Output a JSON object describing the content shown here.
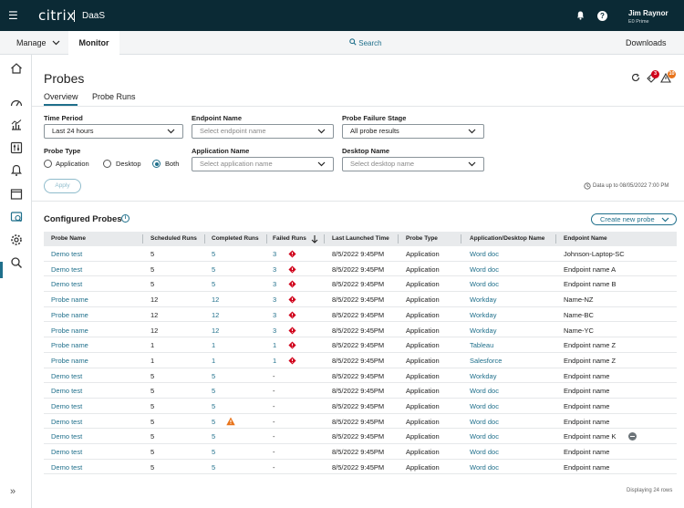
{
  "topbar": {
    "brand": "citrix",
    "product": "DaaS",
    "user_name": "Jim Raynor",
    "user_org": "E0 Prime"
  },
  "nav": {
    "manage": "Manage",
    "monitor": "Monitor",
    "search": "Search",
    "downloads": "Downloads"
  },
  "page": {
    "title": "Probes",
    "tabs": [
      "Overview",
      "Probe Runs"
    ],
    "alert_count_red": "3",
    "alert_count_orange": "10"
  },
  "filters": {
    "time_period": {
      "label": "Time Period",
      "value": "Last 24 hours"
    },
    "endpoint_name": {
      "label": "Endpoint Name",
      "placeholder": "Select endpoint name"
    },
    "failure_stage": {
      "label": "Probe Failure Stage",
      "value": "All probe results"
    },
    "probe_type": {
      "label": "Probe Type",
      "options": [
        "Application",
        "Desktop",
        "Both"
      ],
      "selected": "Both"
    },
    "application_name": {
      "label": "Application Name",
      "placeholder": "Select application name"
    },
    "desktop_name": {
      "label": "Desktop Name",
      "placeholder": "Select desktop name"
    },
    "apply": "Apply",
    "data_upto": "Data up to 08/05/2022 7:00 PM"
  },
  "configured": {
    "title": "Configured Probes",
    "create_button": "Create new probe",
    "columns": [
      "Probe Name",
      "Scheduled Runs",
      "Completed Runs",
      "Failed Runs",
      "Last Launched Time",
      "Probe Type",
      "Application/Desktop Name",
      "Endpoint Name"
    ],
    "rows": [
      {
        "name": "Demo test",
        "scheduled": "5",
        "completed": "5",
        "failed": "3",
        "time": "8/5/2022 9:45PM",
        "type": "Application",
        "app": "Word doc",
        "endpoint": "Johnson-Laptop-SC",
        "err": true,
        "warn": false,
        "minus": false
      },
      {
        "name": "Demo test",
        "scheduled": "5",
        "completed": "5",
        "failed": "3",
        "time": "8/5/2022 9:45PM",
        "type": "Application",
        "app": "Word doc",
        "endpoint": "Endpoint name A",
        "err": true,
        "warn": false,
        "minus": false
      },
      {
        "name": "Demo test",
        "scheduled": "5",
        "completed": "5",
        "failed": "3",
        "time": "8/5/2022 9:45PM",
        "type": "Application",
        "app": "Word doc",
        "endpoint": "Endpoint name B",
        "err": true,
        "warn": false,
        "minus": false
      },
      {
        "name": "Probe name",
        "scheduled": "12",
        "completed": "12",
        "failed": "3",
        "time": "8/5/2022 9:45PM",
        "type": "Application",
        "app": "Workday",
        "endpoint": "Name-NZ",
        "err": true,
        "warn": false,
        "minus": false
      },
      {
        "name": "Probe name",
        "scheduled": "12",
        "completed": "12",
        "failed": "3",
        "time": "8/5/2022 9:45PM",
        "type": "Application",
        "app": "Workday",
        "endpoint": "Name-BC",
        "err": true,
        "warn": false,
        "minus": false
      },
      {
        "name": "Probe name",
        "scheduled": "12",
        "completed": "12",
        "failed": "3",
        "time": "8/5/2022 9:45PM",
        "type": "Application",
        "app": "Workday",
        "endpoint": "Name-YC",
        "err": true,
        "warn": false,
        "minus": false
      },
      {
        "name": "Probe name",
        "scheduled": "1",
        "completed": "1",
        "failed": "1",
        "time": "8/5/2022 9:45PM",
        "type": "Application",
        "app": "Tableau",
        "endpoint": "Endpoint name Z",
        "err": true,
        "warn": false,
        "minus": false
      },
      {
        "name": "Probe name",
        "scheduled": "1",
        "completed": "1",
        "failed": "1",
        "time": "8/5/2022 9:45PM",
        "type": "Application",
        "app": "Salesforce",
        "endpoint": "Endpoint name Z",
        "err": true,
        "warn": false,
        "minus": false
      },
      {
        "name": "Demo test",
        "scheduled": "5",
        "completed": "5",
        "failed": "-",
        "time": "8/5/2022 9:45PM",
        "type": "Application",
        "app": "Workday",
        "endpoint": "Endpoint name",
        "err": false,
        "warn": false,
        "minus": false
      },
      {
        "name": "Demo test",
        "scheduled": "5",
        "completed": "5",
        "failed": "-",
        "time": "8/5/2022 9:45PM",
        "type": "Application",
        "app": "Word doc",
        "endpoint": "Endpoint name",
        "err": false,
        "warn": false,
        "minus": false
      },
      {
        "name": "Demo test",
        "scheduled": "5",
        "completed": "5",
        "failed": "-",
        "time": "8/5/2022 9:45PM",
        "type": "Application",
        "app": "Word doc",
        "endpoint": "Endpoint name",
        "err": false,
        "warn": false,
        "minus": false
      },
      {
        "name": "Demo test",
        "scheduled": "5",
        "completed": "5",
        "failed": "-",
        "time": "8/5/2022 9:45PM",
        "type": "Application",
        "app": "Word doc",
        "endpoint": "Endpoint name",
        "err": false,
        "warn": true,
        "minus": false
      },
      {
        "name": "Demo test",
        "scheduled": "5",
        "completed": "5",
        "failed": "-",
        "time": "8/5/2022 9:45PM",
        "type": "Application",
        "app": "Word doc",
        "endpoint": "Endpoint name K",
        "err": false,
        "warn": false,
        "minus": true
      },
      {
        "name": "Demo test",
        "scheduled": "5",
        "completed": "5",
        "failed": "-",
        "time": "8/5/2022 9:45PM",
        "type": "Application",
        "app": "Word doc",
        "endpoint": "Endpoint name",
        "err": false,
        "warn": false,
        "minus": false
      },
      {
        "name": "Demo test",
        "scheduled": "5",
        "completed": "5",
        "failed": "-",
        "time": "8/5/2022 9:45PM",
        "type": "Application",
        "app": "Word doc",
        "endpoint": "Endpoint name",
        "err": false,
        "warn": false,
        "minus": false
      }
    ],
    "footer": "Displaying 24 rows"
  },
  "colors": {
    "accent": "#1f6f8b",
    "topbar": "#0b2a35",
    "error": "#d0021b",
    "warning": "#e8731a"
  },
  "icons": [
    "menu-icon",
    "bell-icon",
    "help-icon",
    "home-icon",
    "dashboard-icon",
    "chart-icon",
    "filters-icon",
    "alerts-icon",
    "window-icon",
    "probes-icon",
    "settings-icon",
    "search-icon",
    "refresh-icon",
    "alert-tag-icon",
    "warning-triangle-icon",
    "info-icon",
    "clock-icon",
    "expand-icon"
  ]
}
